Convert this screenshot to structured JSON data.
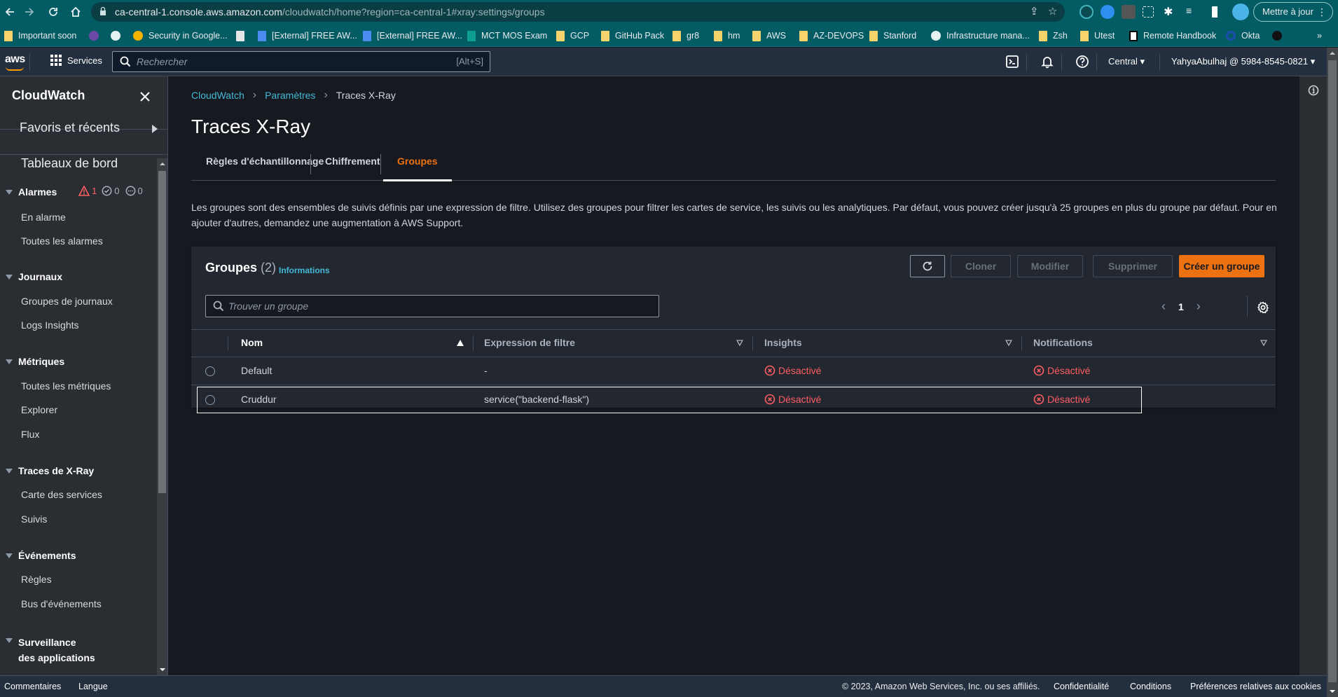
{
  "browser": {
    "url_host": "ca-central-1.console.aws.amazon.com",
    "url_path": "/cloudwatch/home?region=ca-central-1#xray:settings/groups",
    "update_button": "Mettre à jour",
    "bookmarks": [
      {
        "label": "Important soon",
        "icon": "folder"
      },
      {
        "label": "",
        "icon": "nit-logo"
      },
      {
        "label": "",
        "icon": "globe"
      },
      {
        "label": "Security in Google...",
        "icon": "google-cloud"
      },
      {
        "label": "",
        "icon": "document"
      },
      {
        "label": "[External] FREE AW...",
        "icon": "google-docs"
      },
      {
        "label": "[External] FREE AW...",
        "icon": "google-docs"
      },
      {
        "label": "MCT MOS Exam",
        "icon": "forms"
      },
      {
        "label": "GCP",
        "icon": "folder"
      },
      {
        "label": "GitHub Pack",
        "icon": "folder"
      },
      {
        "label": "gr8",
        "icon": "folder"
      },
      {
        "label": "hm",
        "icon": "folder"
      },
      {
        "label": "AWS",
        "icon": "folder"
      },
      {
        "label": "AZ-DEVOPS",
        "icon": "folder"
      },
      {
        "label": "Stanford",
        "icon": "folder"
      },
      {
        "label": "Infrastructure mana...",
        "icon": "globe"
      },
      {
        "label": "Zsh",
        "icon": "folder"
      },
      {
        "label": "Utest",
        "icon": "folder"
      },
      {
        "label": "Remote Handbook",
        "icon": "notion"
      },
      {
        "label": "Okta",
        "icon": "okta"
      },
      {
        "label": "",
        "icon": "github"
      }
    ],
    "more_bookmarks": "»"
  },
  "header": {
    "logo": "aws",
    "services": "Services",
    "search_placeholder": "Rechercher",
    "search_shortcut": "[Alt+S]",
    "region": "Central",
    "account": "YahyaAbulhaj @ 5984-8545-0821"
  },
  "sidebar": {
    "title": "CloudWatch",
    "favorites": "Favoris et récents",
    "dashboards": "Tableaux de bord",
    "sections": [
      {
        "title": "Alarmes",
        "items": [
          "En alarme",
          "Toutes les alarmes"
        ]
      },
      {
        "title": "Journaux",
        "items": [
          "Groupes de journaux",
          "Logs Insights"
        ]
      },
      {
        "title": "Métriques",
        "items": [
          "Toutes les métriques",
          "Explorer",
          "Flux"
        ]
      },
      {
        "title": "Traces de X-Ray",
        "items": [
          "Carte des services",
          "Suivis"
        ]
      },
      {
        "title": "Événements",
        "items": [
          "Règles",
          "Bus d'événements"
        ]
      },
      {
        "title": "Surveillance des applications",
        "title_line1": "Surveillance",
        "title_line2": "des applications",
        "items": []
      }
    ],
    "alarm_counts": {
      "in_alarm": "1",
      "ok": "0",
      "insufficient": "0"
    }
  },
  "breadcrumb": [
    "CloudWatch",
    "Paramètres",
    "Traces X-Ray"
  ],
  "page_title": "Traces X-Ray",
  "tabs": [
    {
      "label": "Règles d'échantillonnage",
      "active": false
    },
    {
      "label": "Chiffrement",
      "active": false
    },
    {
      "label": "Groupes",
      "active": true
    }
  ],
  "description": "Les groupes sont des ensembles de suivis définis par une expression de filtre. Utilisez des groupes pour filtrer les cartes de service, les suivis ou les analytiques. Par défaut, vous pouvez créer jusqu'à 25 groupes en plus du groupe par défaut. Pour en ajouter d'autres, demandez une augmentation à AWS Support.",
  "groups_panel": {
    "title": "Groupes",
    "count": "(2)",
    "info_link": "Informations",
    "buttons": {
      "clone": "Cloner",
      "modify": "Modifier",
      "delete": "Supprimer",
      "create": "Créer un groupe"
    },
    "search_placeholder": "Trouver un groupe",
    "current_page": "1",
    "columns": [
      "Nom",
      "Expression de filtre",
      "Insights",
      "Notifications"
    ],
    "sort": {
      "column": "Nom",
      "direction": "ascending"
    },
    "rows": [
      {
        "name": "Default",
        "filter": "-",
        "insights": "Désactivé",
        "notifications": "Désactivé",
        "selected": false
      },
      {
        "name": "Cruddur",
        "filter": "service(\"backend-flask\")",
        "insights": "Désactivé",
        "notifications": "Désactivé",
        "selected": false
      }
    ]
  },
  "footer": {
    "feedback": "Commentaires",
    "language": "Langue",
    "copyright": "© 2023, Amazon Web Services, Inc. ou ses affiliés.",
    "privacy": "Confidentialité",
    "terms": "Conditions",
    "cookies": "Préférences relatives aux cookies"
  },
  "colors": {
    "accent_orange": "#ec7211",
    "link_blue": "#44b9d6",
    "error_red": "#ff5d64",
    "header_bg": "#232f3e",
    "browser_bg": "#035b63"
  }
}
